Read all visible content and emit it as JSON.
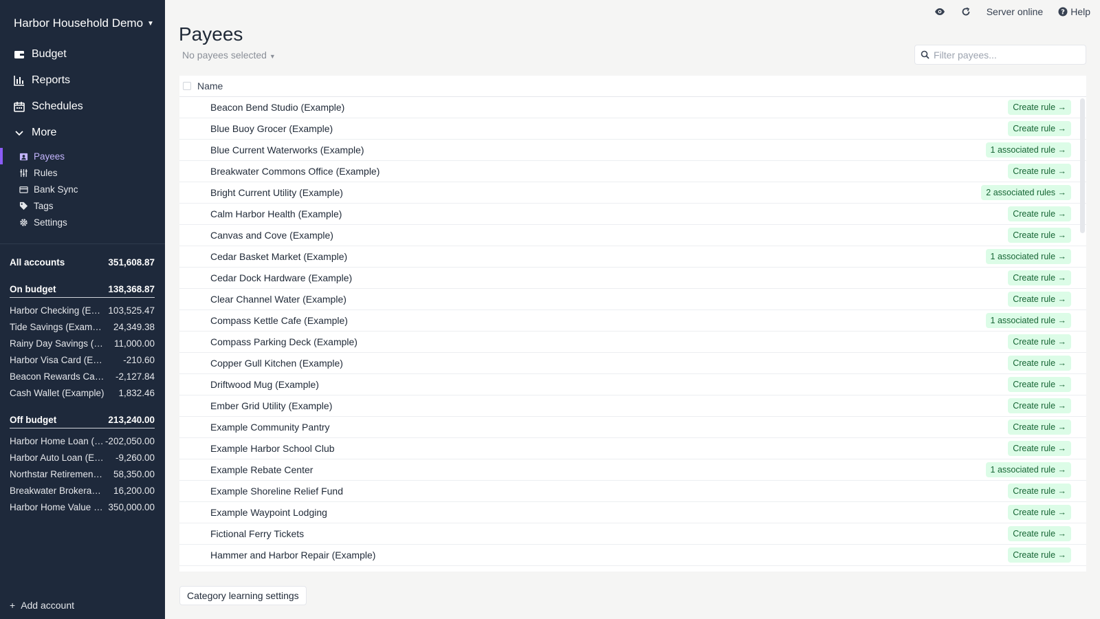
{
  "sidebar": {
    "budget_name": "Harbor Household Demo",
    "nav": [
      {
        "label": "Budget",
        "icon": "wallet-icon"
      },
      {
        "label": "Reports",
        "icon": "bar-chart-icon"
      },
      {
        "label": "Schedules",
        "icon": "calendar-icon"
      },
      {
        "label": "More",
        "icon": "chevron-down-icon"
      }
    ],
    "sub_nav": [
      {
        "label": "Payees",
        "icon": "payees-icon",
        "active": true
      },
      {
        "label": "Rules",
        "icon": "rules-icon"
      },
      {
        "label": "Bank Sync",
        "icon": "credit-card-icon"
      },
      {
        "label": "Tags",
        "icon": "tag-icon"
      },
      {
        "label": "Settings",
        "icon": "gear-icon"
      }
    ],
    "all_accounts": {
      "label": "All accounts",
      "value": "351,608.87"
    },
    "on_budget": {
      "label": "On budget",
      "value": "138,368.87",
      "accounts": [
        {
          "name": "Harbor Checking (Example)",
          "value": "103,525.47"
        },
        {
          "name": "Tide Savings (Example)",
          "value": "24,349.38"
        },
        {
          "name": "Rainy Day Savings (Example)",
          "value": "11,000.00"
        },
        {
          "name": "Harbor Visa Card (Example)",
          "value": "-210.60"
        },
        {
          "name": "Beacon Rewards Card (Example)",
          "value": "-2,127.84"
        },
        {
          "name": "Cash Wallet (Example)",
          "value": "1,832.46"
        }
      ]
    },
    "off_budget": {
      "label": "Off budget",
      "value": "213,240.00",
      "accounts": [
        {
          "name": "Harbor Home Loan (Example)",
          "value": "-202,050.00"
        },
        {
          "name": "Harbor Auto Loan (Example)",
          "value": "-9,260.00"
        },
        {
          "name": "Northstar Retirement (Example)",
          "value": "58,350.00"
        },
        {
          "name": "Breakwater Brokerage (Example)",
          "value": "16,200.00"
        },
        {
          "name": "Harbor Home Value (Example)",
          "value": "350,000.00"
        }
      ]
    },
    "add_account": "Add account"
  },
  "topbar": {
    "server_status": "Server online",
    "help": "Help"
  },
  "page": {
    "title": "Payees",
    "selection": "No payees selected",
    "filter_placeholder": "Filter payees...",
    "column_name": "Name",
    "footer_button": "Category learning settings"
  },
  "payees": [
    {
      "name": "Beacon Bend Studio (Example)",
      "rule": "Create rule →"
    },
    {
      "name": "Blue Buoy Grocer (Example)",
      "rule": "Create rule →"
    },
    {
      "name": "Blue Current Waterworks (Example)",
      "rule": "1 associated rule →"
    },
    {
      "name": "Breakwater Commons Office (Example)",
      "rule": "Create rule →"
    },
    {
      "name": "Bright Current Utility (Example)",
      "rule": "2 associated rules →"
    },
    {
      "name": "Calm Harbor Health (Example)",
      "rule": "Create rule →"
    },
    {
      "name": "Canvas and Cove (Example)",
      "rule": "Create rule →"
    },
    {
      "name": "Cedar Basket Market (Example)",
      "rule": "1 associated rule →"
    },
    {
      "name": "Cedar Dock Hardware (Example)",
      "rule": "Create rule →"
    },
    {
      "name": "Clear Channel Water (Example)",
      "rule": "Create rule →"
    },
    {
      "name": "Compass Kettle Cafe (Example)",
      "rule": "1 associated rule →"
    },
    {
      "name": "Compass Parking Deck (Example)",
      "rule": "Create rule →"
    },
    {
      "name": "Copper Gull Kitchen (Example)",
      "rule": "Create rule →"
    },
    {
      "name": "Driftwood Mug (Example)",
      "rule": "Create rule →"
    },
    {
      "name": "Ember Grid Utility (Example)",
      "rule": "Create rule →"
    },
    {
      "name": "Example Community Pantry",
      "rule": "Create rule →"
    },
    {
      "name": "Example Harbor School Club",
      "rule": "Create rule →"
    },
    {
      "name": "Example Rebate Center",
      "rule": "1 associated rule →"
    },
    {
      "name": "Example Shoreline Relief Fund",
      "rule": "Create rule →"
    },
    {
      "name": "Example Waypoint Lodging",
      "rule": "Create rule →"
    },
    {
      "name": "Fictional Ferry Tickets",
      "rule": "Create rule →"
    },
    {
      "name": "Hammer and Harbor Repair (Example)",
      "rule": "Create rule →"
    },
    {
      "name": "",
      "rule": ""
    }
  ]
}
